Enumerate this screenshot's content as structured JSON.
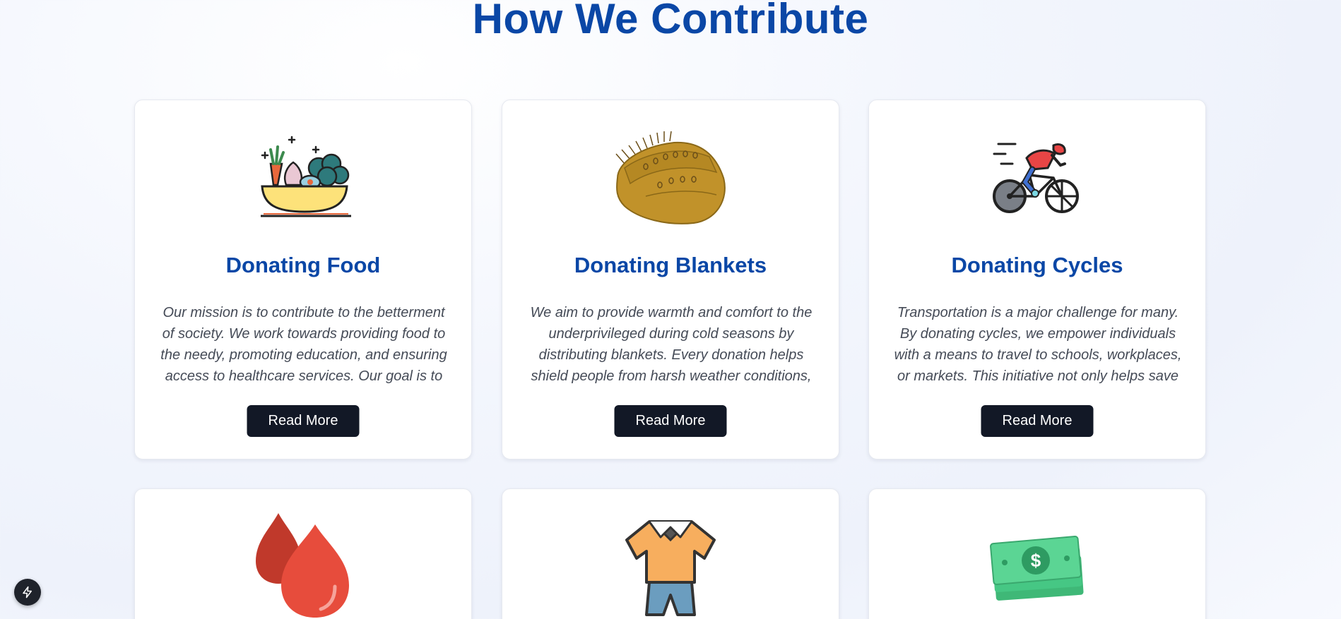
{
  "section": {
    "title": "How We Contribute"
  },
  "cards": [
    {
      "title": "Donating Food",
      "description": "Our mission is to contribute to the betterment of society. We work towards providing food to the needy, promoting education, and ensuring access to healthcare services. Our goal is to",
      "button": "Read More",
      "icon": "food-bowl-icon"
    },
    {
      "title": "Donating Blankets",
      "description": "We aim to provide warmth and comfort to the underprivileged during cold seasons by distributing blankets. Every donation helps shield people from harsh weather conditions,",
      "button": "Read More",
      "icon": "blanket-icon"
    },
    {
      "title": "Donating Cycles",
      "description": "Transportation is a major challenge for many. By donating cycles, we empower individuals with a means to travel to schools, workplaces, or markets. This initiative not only helps save",
      "button": "Read More",
      "icon": "cyclist-icon"
    },
    {
      "icon": "blood-drops-icon"
    },
    {
      "icon": "clothes-icon"
    },
    {
      "icon": "money-icon"
    }
  ],
  "floating_button": {
    "icon": "lightning-icon"
  },
  "colors": {
    "heading": "#0a47a6",
    "button_bg": "#121826",
    "button_text": "#ffffff",
    "body_text": "#454b57"
  }
}
